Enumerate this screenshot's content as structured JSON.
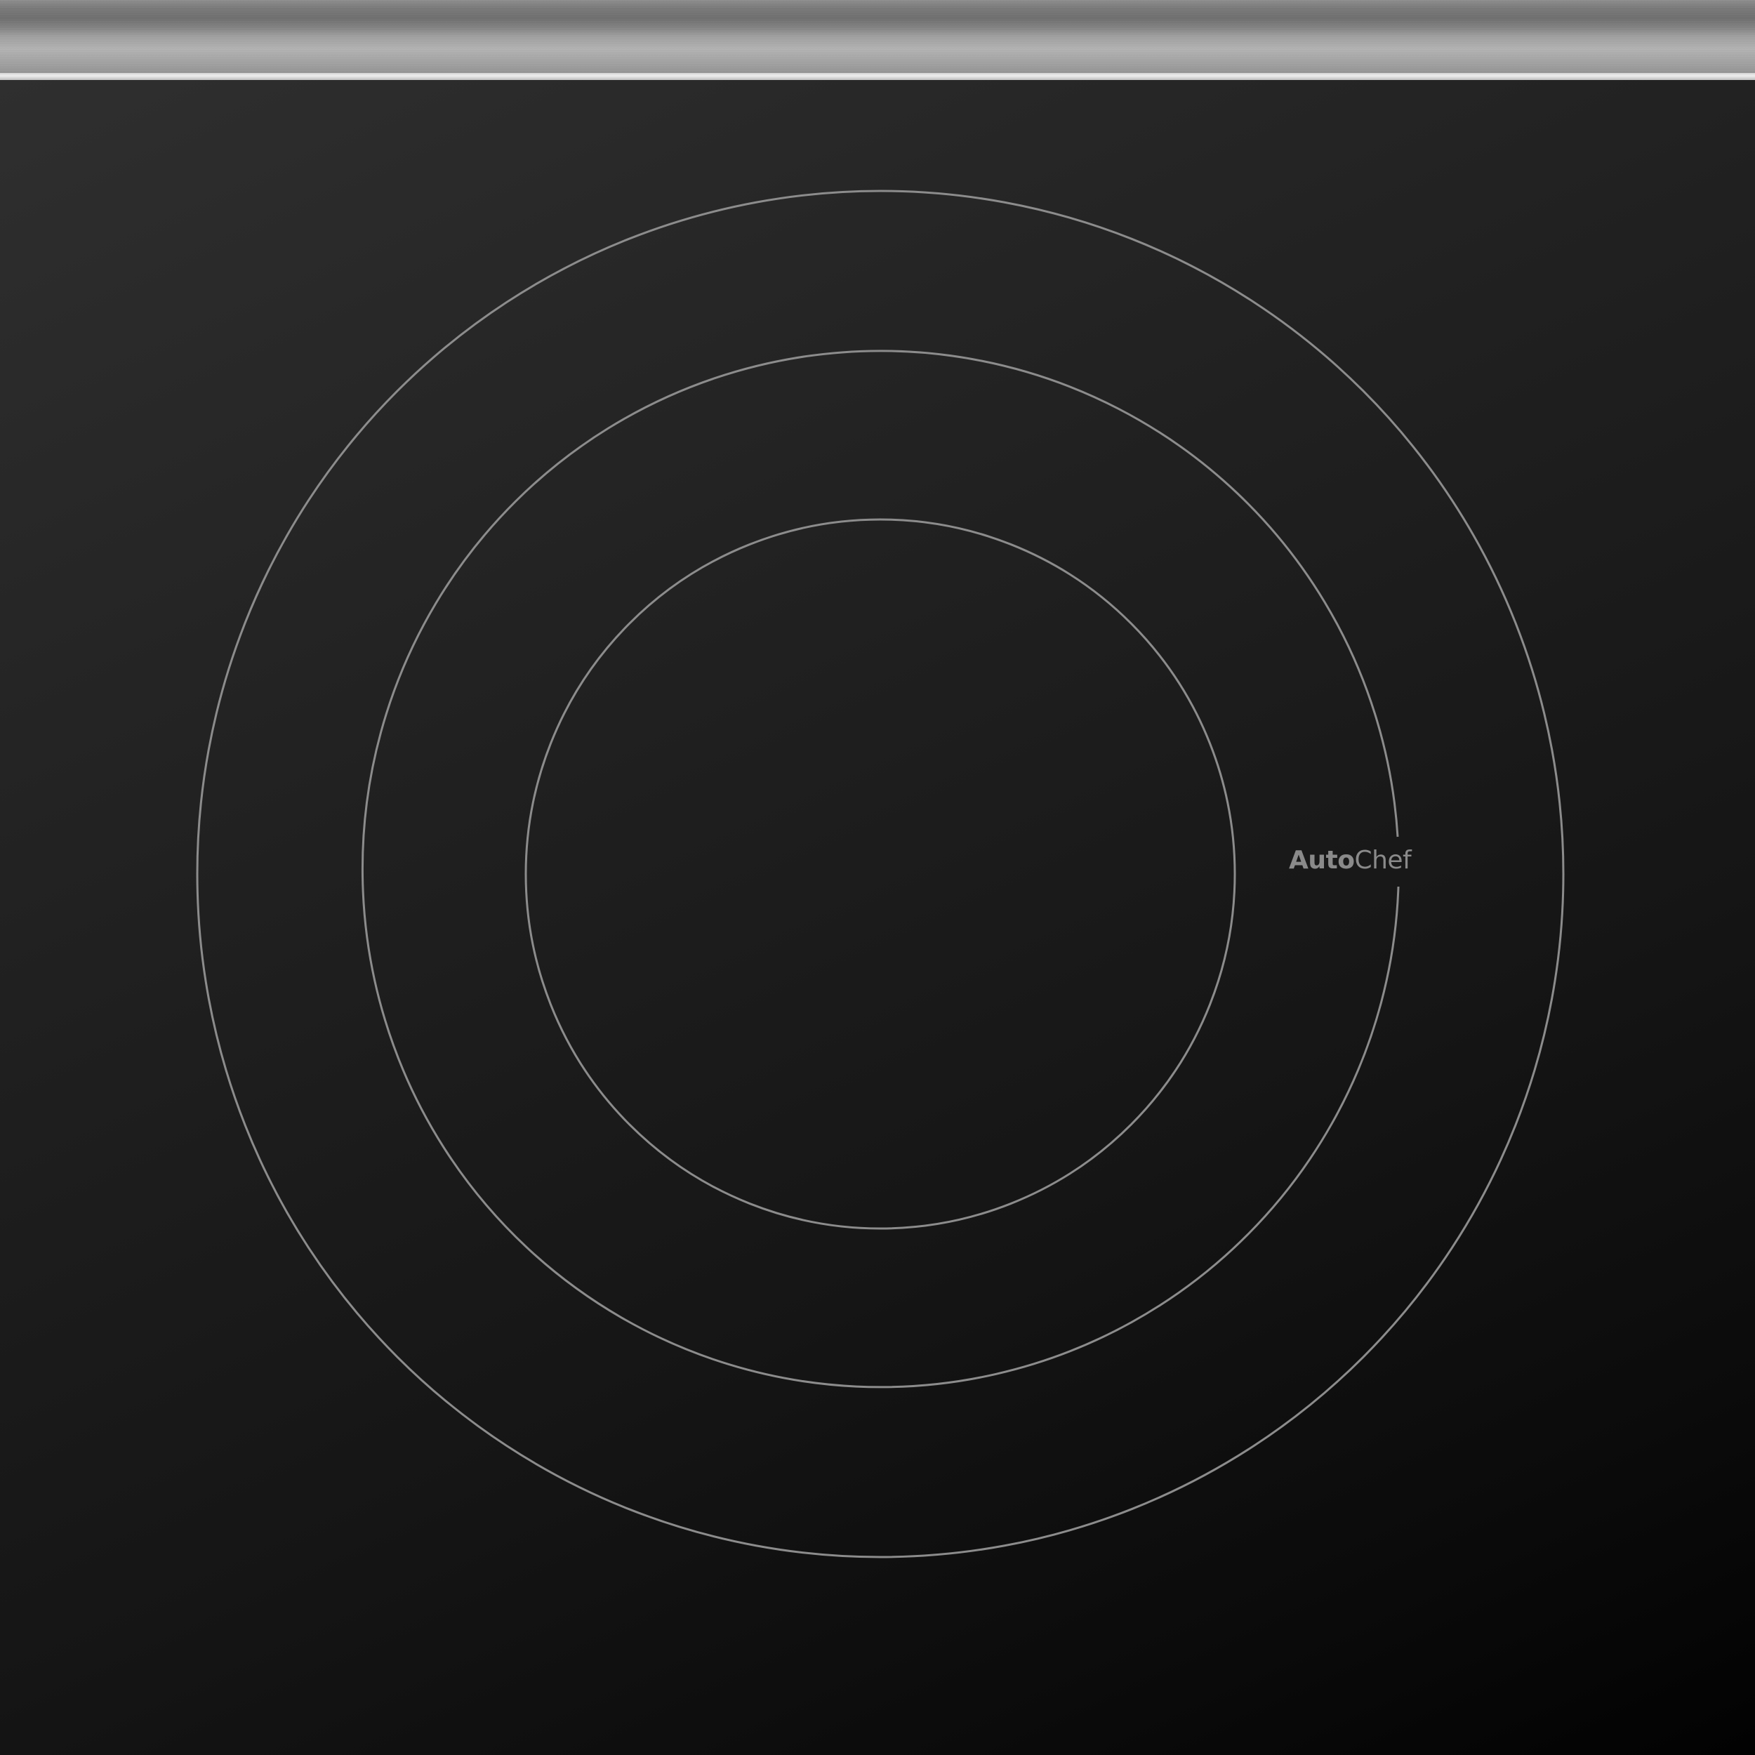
{
  "brand": {
    "name_bold": "Auto",
    "name_light": "Chef"
  },
  "colors": {
    "ring": "#8c8c8c",
    "glass_top": "#2f2f2f",
    "glass_bottom": "#020202",
    "steel": "#a2a2a2",
    "brand_text": "#8a8a8a"
  }
}
